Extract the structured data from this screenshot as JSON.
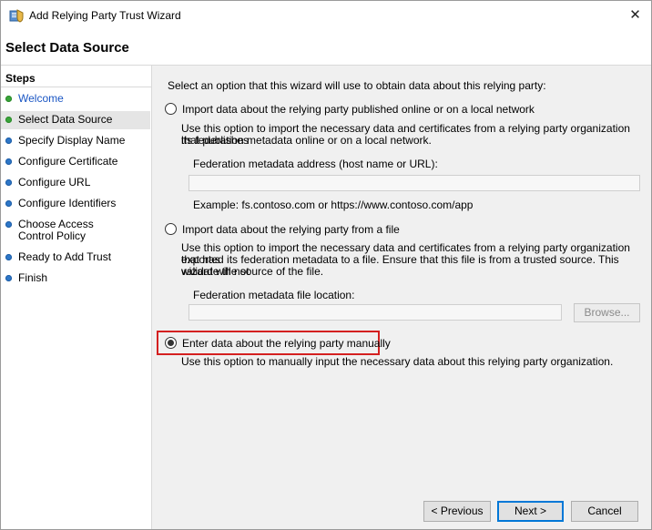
{
  "window": {
    "title": "Add Relying Party Trust Wizard",
    "close_glyph": "✕",
    "app_icon": "relying-party-trust-icon"
  },
  "header": {
    "page_title": "Select Data Source"
  },
  "steps": {
    "heading": "Steps",
    "items": [
      {
        "label": "Welcome",
        "status": "done",
        "link": true
      },
      {
        "label": "Select Data Source",
        "status": "done",
        "current": true
      },
      {
        "label": "Specify Display Name",
        "status": "todo"
      },
      {
        "label": "Configure Certificate",
        "status": "todo"
      },
      {
        "label": "Configure URL",
        "status": "todo"
      },
      {
        "label": "Configure Identifiers",
        "status": "todo"
      },
      {
        "label": "Choose Access Control Policy",
        "status": "todo"
      },
      {
        "label": "Ready to Add Trust",
        "status": "todo"
      },
      {
        "label": "Finish",
        "status": "todo"
      }
    ]
  },
  "main": {
    "intro": "Select an option that this wizard will use to obtain data about this relying party:",
    "option_online": {
      "label": "Import data about the relying party published online or on a local network",
      "desc_line1": "Use this option to import the necessary data and certificates from a relying party organization that publishes",
      "desc_line2": "its federation metadata online or on a local network.",
      "field_label": "Federation metadata address (host name or URL):",
      "field_value": "",
      "example": "Example: fs.contoso.com or https://www.contoso.com/app",
      "selected": false
    },
    "option_file": {
      "label": "Import data about the relying party from a file",
      "desc_line1": "Use this option to import the necessary data and certificates from a relying party organization that has",
      "desc_line2": "exported its federation metadata to a file. Ensure that this file is from a trusted source.  This wizard will not",
      "desc_line3": "validate the source of the file.",
      "field_label": "Federation metadata file location:",
      "field_value": "",
      "browse_label": "Browse...",
      "selected": false
    },
    "option_manual": {
      "label": "Enter data about the relying party manually",
      "desc": "Use this option to manually input the necessary data about this relying party organization.",
      "selected": true
    }
  },
  "footer": {
    "previous_label": "< Previous",
    "next_label": "Next >",
    "cancel_label": "Cancel"
  },
  "colors": {
    "step_done": "#3aa53a",
    "step_todo": "#2e77c8",
    "link": "#1a56c4",
    "highlight": "#d42020",
    "default_button_border": "#0078d7"
  }
}
